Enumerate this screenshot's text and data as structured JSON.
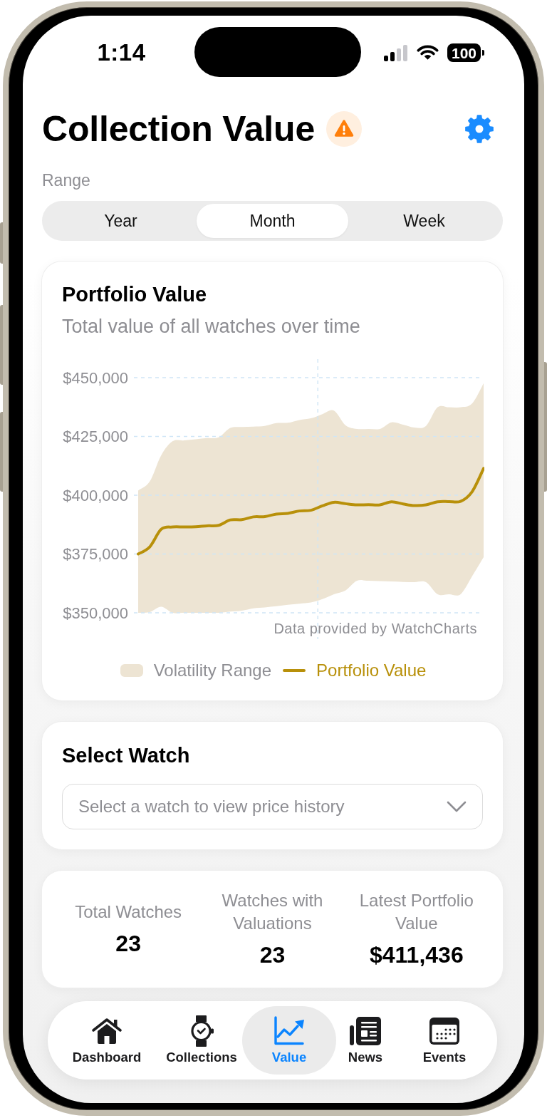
{
  "status_bar": {
    "time": "1:14",
    "battery": "100"
  },
  "header": {
    "title": "Collection Value"
  },
  "range": {
    "label": "Range",
    "options": [
      {
        "label": "Year",
        "selected": false
      },
      {
        "label": "Month",
        "selected": true
      },
      {
        "label": "Week",
        "selected": false
      }
    ]
  },
  "portfolio_card": {
    "title": "Portfolio Value",
    "subtitle": "Total value of all watches over time",
    "chart_data": {
      "type": "line",
      "grid": true,
      "ylim": [
        350000,
        450000
      ],
      "yticks": [
        {
          "value": 350000,
          "label": "$350,000"
        },
        {
          "value": 375000,
          "label": "$375,000"
        },
        {
          "value": 400000,
          "label": "$400,000"
        },
        {
          "value": 425000,
          "label": "$425,000"
        },
        {
          "value": 450000,
          "label": "$450,000"
        }
      ],
      "series": [
        {
          "name": "Volatility Range",
          "color": "#ede4d3",
          "values": [
            null,
            null,
            null,
            null,
            null,
            null,
            null,
            null,
            null,
            null,
            null,
            null,
            null,
            null,
            null,
            null,
            null,
            null,
            null,
            null,
            null,
            null,
            null,
            null,
            null,
            null,
            null,
            null,
            null,
            null,
            null
          ],
          "lower": [
            350000,
            350300,
            352600,
            350000,
            350000,
            350000,
            350000,
            350000,
            350500,
            350900,
            351900,
            352300,
            352800,
            353400,
            353900,
            354400,
            355800,
            357900,
            359500,
            363600,
            363600,
            363500,
            363300,
            363100,
            363000,
            363000,
            357900,
            357900,
            357900,
            365500,
            373600
          ],
          "upper": [
            402000,
            405800,
            417000,
            423000,
            423300,
            423800,
            424300,
            424600,
            428600,
            429000,
            429200,
            429500,
            430700,
            430800,
            432000,
            432700,
            434500,
            436000,
            429800,
            428200,
            428200,
            428200,
            431000,
            430000,
            428800,
            429500,
            437400,
            437400,
            437400,
            439000,
            447600
          ]
        },
        {
          "name": "Portfolio Value",
          "color": "#b8900a",
          "values": [
            375000,
            378000,
            385500,
            386500,
            386500,
            386600,
            387000,
            387200,
            389500,
            389600,
            390800,
            390900,
            392000,
            392300,
            393300,
            393600,
            395500,
            397000,
            396400,
            395900,
            396000,
            395900,
            397200,
            396300,
            395600,
            395900,
            397200,
            397300,
            397400,
            401500,
            411400
          ]
        }
      ]
    },
    "source_note": "Data provided by WatchCharts"
  },
  "select_watch": {
    "title": "Select Watch",
    "dropdown": {
      "placeholder": "Select a watch to view price history"
    }
  },
  "stats": [
    {
      "label": "Total Watches",
      "value": "23"
    },
    {
      "label": "Watches with Valuations",
      "value": "23"
    },
    {
      "label": "Latest Portfolio Value",
      "value": "$411,436"
    }
  ],
  "tab_bar": [
    {
      "label": "Dashboard",
      "selected": false
    },
    {
      "label": "Collections",
      "selected": false
    },
    {
      "label": "Value",
      "selected": true
    },
    {
      "label": "News",
      "selected": false
    },
    {
      "label": "Events",
      "selected": false
    }
  ]
}
